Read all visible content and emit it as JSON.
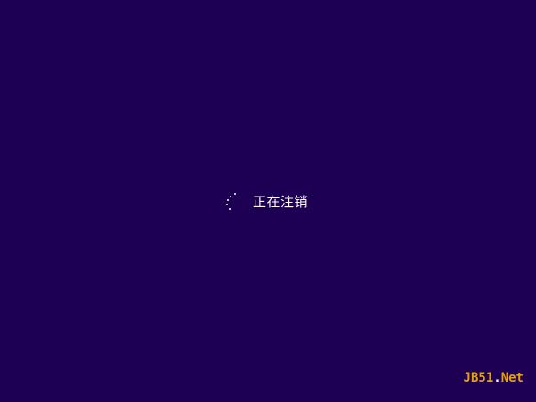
{
  "screen": {
    "background_color": "#1d0054",
    "status_text": "正在注销",
    "spinner_icon": "loading-dots-icon"
  },
  "watermark": {
    "part_a": "JB51",
    "part_b": ".",
    "part_c": "Net",
    "color_primary": "#e8a200",
    "color_secondary": "#ffffff"
  }
}
